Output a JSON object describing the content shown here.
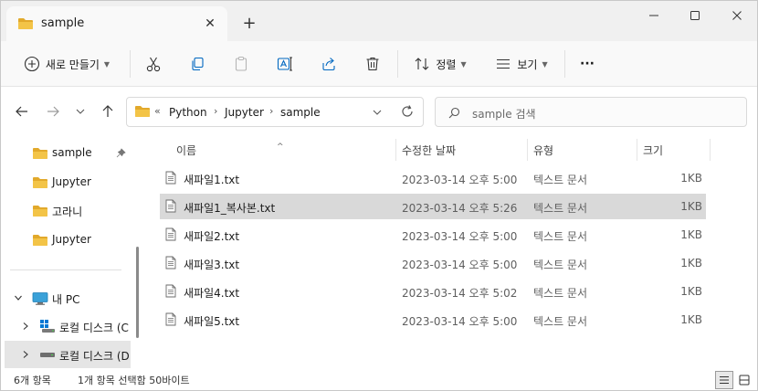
{
  "tab": {
    "title": "sample",
    "close": "✕",
    "new": "+"
  },
  "toolbar": {
    "new_label": "새로 만들기",
    "sort_label": "정렬",
    "view_label": "보기",
    "more": "···"
  },
  "address": {
    "prefix": "«",
    "crumbs": [
      "Python",
      "Jupyter",
      "sample"
    ],
    "sep": "›"
  },
  "search": {
    "placeholder": "sample 검색"
  },
  "sidebar": {
    "quick": [
      "sample",
      "Jupyter",
      "고라니",
      "Jupyter"
    ],
    "pc": "내 PC",
    "drives": [
      "로컬 디스크 (C",
      "로컬 디스크 (D"
    ]
  },
  "columns": {
    "name": "이름",
    "date": "수정한 날짜",
    "type": "유형",
    "size": "크기"
  },
  "files": [
    {
      "name": "새파일1.txt",
      "date": "2023-03-14 오후 5:00",
      "type": "텍스트 문서",
      "size": "1KB",
      "selected": false
    },
    {
      "name": "새파일1_복사본.txt",
      "date": "2023-03-14 오후 5:26",
      "type": "텍스트 문서",
      "size": "1KB",
      "selected": true
    },
    {
      "name": "새파일2.txt",
      "date": "2023-03-14 오후 5:00",
      "type": "텍스트 문서",
      "size": "1KB",
      "selected": false
    },
    {
      "name": "새파일3.txt",
      "date": "2023-03-14 오후 5:00",
      "type": "텍스트 문서",
      "size": "1KB",
      "selected": false
    },
    {
      "name": "새파일4.txt",
      "date": "2023-03-14 오후 5:02",
      "type": "텍스트 문서",
      "size": "1KB",
      "selected": false
    },
    {
      "name": "새파일5.txt",
      "date": "2023-03-14 오후 5:00",
      "type": "텍스트 문서",
      "size": "1KB",
      "selected": false
    }
  ],
  "status": {
    "count": "6개 항목",
    "selection": "1개 항목 선택함 50바이트"
  },
  "colors": {
    "folder": "#f3c447",
    "folder_dark": "#e2a92b",
    "accent": "#0067c0",
    "selected_row": "#d9d9d9"
  }
}
